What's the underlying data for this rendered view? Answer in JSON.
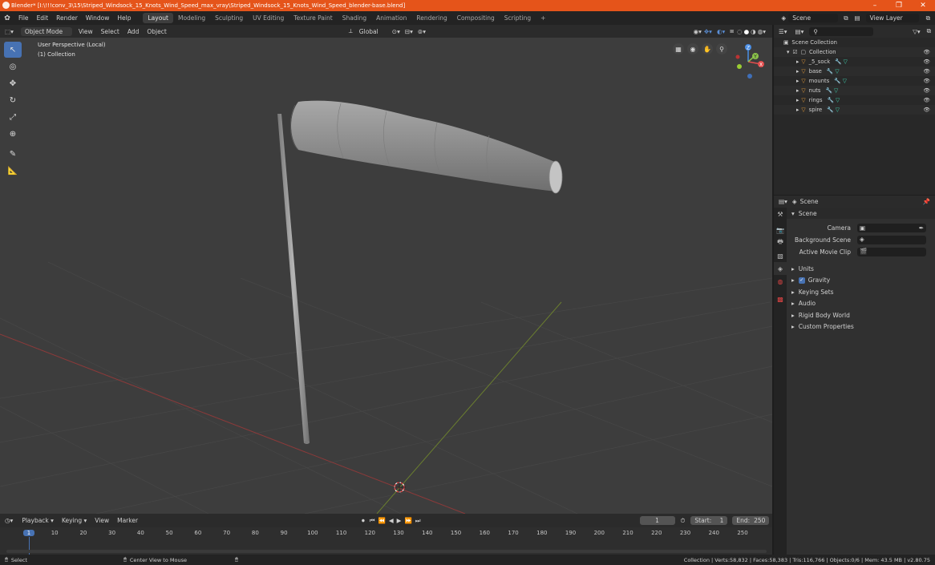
{
  "window": {
    "title": "Blender* [I:\\!!!conv_3\\15\\Striped_Windsock_15_Knots_Wind_Speed_max_vray\\Striped_Windsock_15_Knots_Wind_Speed_blender-base.blend]",
    "controls": [
      "–",
      "❐",
      "✕"
    ]
  },
  "menubar": {
    "items": [
      "File",
      "Edit",
      "Render",
      "Window",
      "Help"
    ],
    "workspaces": [
      "Layout",
      "Modeling",
      "Sculpting",
      "UV Editing",
      "Texture Paint",
      "Shading",
      "Animation",
      "Rendering",
      "Compositing",
      "Scripting"
    ],
    "active_workspace": "Layout",
    "add_workspace": "+",
    "scene": "Scene",
    "view_layer": "View Layer"
  },
  "viewport_header": {
    "mode": "Object Mode",
    "menus": [
      "View",
      "Select",
      "Add",
      "Object"
    ],
    "orientation": "Global"
  },
  "viewport": {
    "perspective": "User Perspective (Local)",
    "collection": "(1) Collection",
    "gizmo": {
      "x": "X",
      "y": "Y",
      "z": "Z"
    }
  },
  "outliner": {
    "search_placeholder": "",
    "root": "Scene Collection",
    "collection": "Collection",
    "objects": [
      "_5_sock",
      "base",
      "mounts",
      "nuts",
      "rings",
      "spire"
    ]
  },
  "properties": {
    "header": "Scene",
    "panel": "Scene",
    "fields": [
      {
        "label": "Camera",
        "value": ""
      },
      {
        "label": "Background Scene",
        "value": ""
      },
      {
        "label": "Active Movie Clip",
        "value": ""
      }
    ],
    "subpanels": [
      "Units",
      "Gravity",
      "Keying Sets",
      "Audio",
      "Rigid Body World",
      "Custom Properties"
    ],
    "gravity_checked": true
  },
  "timeline": {
    "menus": [
      "Playback",
      "Keying",
      "View",
      "Marker"
    ],
    "current_frame": "1",
    "start_label": "Start:",
    "start": "1",
    "end_label": "End:",
    "end": "250",
    "ticks": [
      "1",
      "10",
      "20",
      "30",
      "40",
      "50",
      "60",
      "70",
      "80",
      "90",
      "100",
      "110",
      "120",
      "130",
      "140",
      "150",
      "160",
      "170",
      "180",
      "190",
      "200",
      "210",
      "220",
      "230",
      "240",
      "250"
    ]
  },
  "statusbar": {
    "select": "Select",
    "center": "Center View to Mouse",
    "stats": "Collection | Verts:58,832 | Faces:58,383 | Tris:116,766 | Objects:0/6 | Mem: 43.5 MB | v2.80.75"
  },
  "colors": {
    "accent": "#4772b3",
    "titlebar": "#e5541a",
    "x_axis": "#e44d4d",
    "y_axis": "#8bc34a",
    "z_axis": "#4a8ee5"
  }
}
